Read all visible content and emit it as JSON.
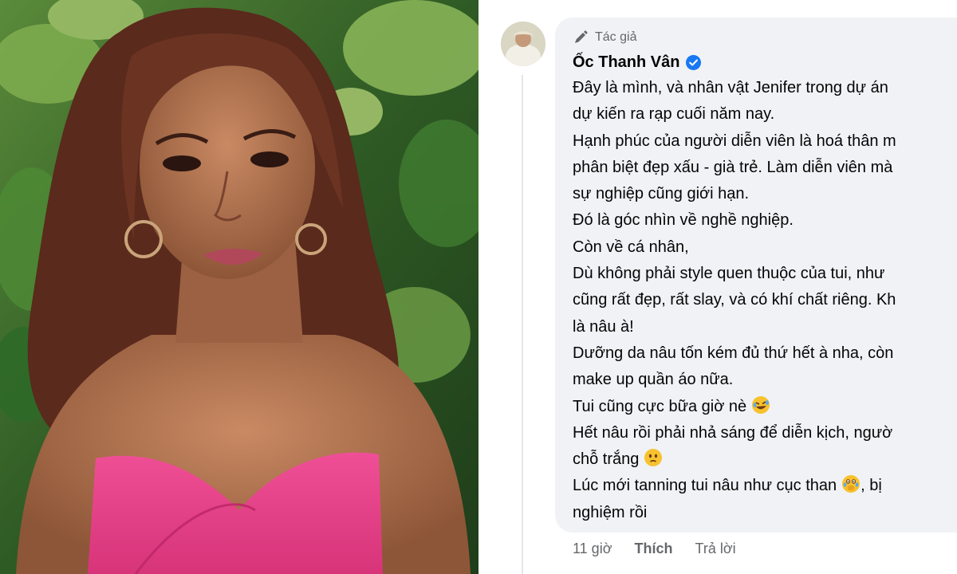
{
  "comment": {
    "badge_label": "Tác giả",
    "badge_icon": "pencil-icon",
    "author_name": "Ốc Thanh Vân",
    "verified_icon": "verified-badge-icon",
    "verified_color": "#1877f2",
    "lines": [
      "Đây là mình, và nhân vật Jenifer trong dự án",
      "dự kiến ra rạp cuối năm nay.",
      "Hạnh phúc của người diễn viên là hoá thân m",
      "phân biệt đẹp xấu - già trẻ. Làm diễn viên mà",
      "sự nghiệp cũng giới hạn.",
      "Đó là góc nhìn về nghề nghiệp.",
      "Còn về cá nhân,",
      "Dù không phải style quen thuộc của tui, như",
      "cũng rất đẹp, rất slay, và có khí chất riêng. Kh",
      "là nâu à!",
      "Dưỡng da nâu tốn kém đủ thứ hết à nha, còn",
      "make up quần áo nữa.",
      "Tui cũng cực bữa giờ nè",
      "Hết nâu rồi phải nhả sáng để diễn kịch, ngườ",
      "chỗ trắng",
      "Lúc mới tanning tui nâu như cục than",
      "nghiệm rồi"
    ],
    "line13_tail": "",
    "line16_tail": ", bị",
    "emojis": {
      "rofl": "rolling-on-floor-laughing-emoji",
      "worried": "worried-face-emoji",
      "shocked": "face-with-hand-over-mouth-emoji"
    },
    "actions": {
      "time": "11 giờ",
      "like": "Thích",
      "reply": "Trả lời"
    }
  },
  "colors": {
    "bubble_bg": "#f0f2f5",
    "text": "#050505",
    "secondary_text": "#65676b",
    "dress_pink": "#e8428c",
    "foliage_green": "#2f6b2a"
  }
}
